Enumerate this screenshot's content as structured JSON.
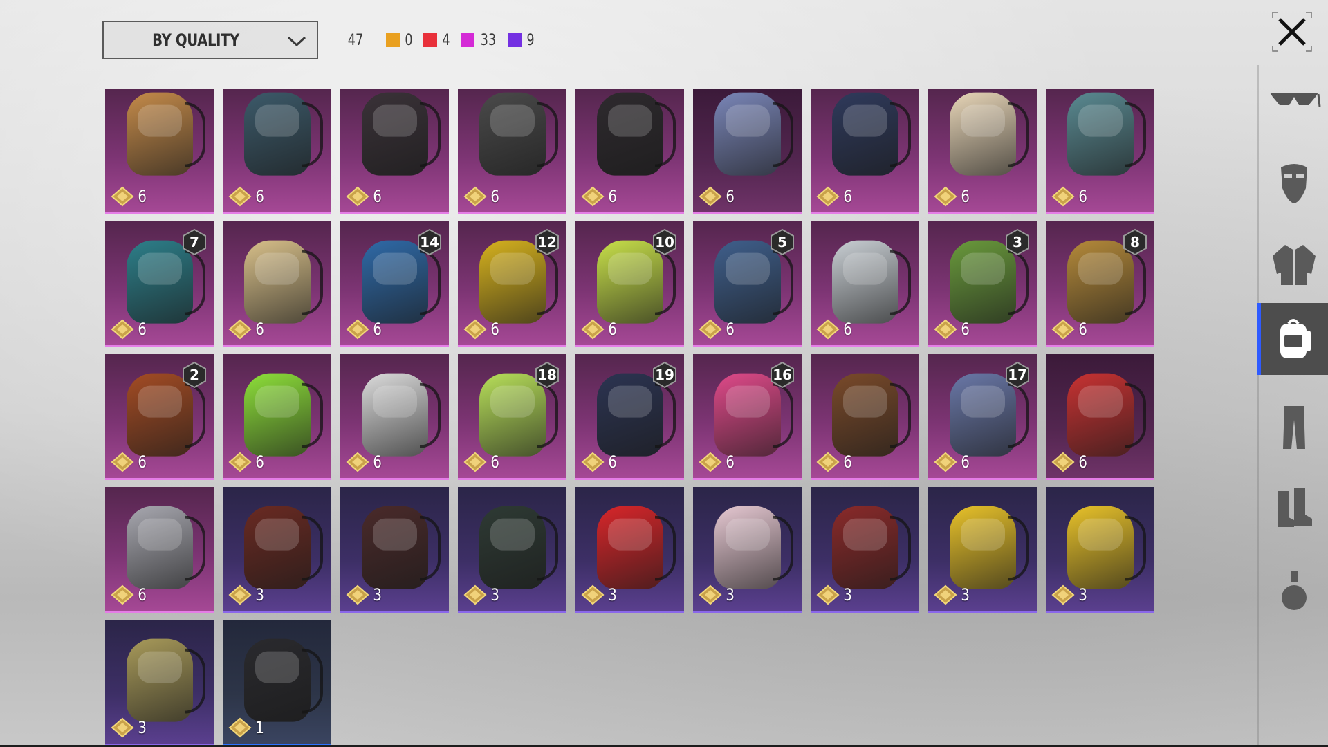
{
  "toolbar": {
    "sort_label": "BY QUALITY",
    "total_count": "47",
    "quality_counts": [
      {
        "color": "#e9a020",
        "count": "0"
      },
      {
        "color": "#e8303a",
        "count": "4"
      },
      {
        "color": "#d42ad6",
        "count": "33"
      },
      {
        "color": "#7430e2",
        "count": "9"
      }
    ]
  },
  "sidebar": {
    "categories": [
      {
        "icon": "glasses-icon",
        "active": false
      },
      {
        "icon": "mask-icon",
        "active": false
      },
      {
        "icon": "jacket-icon",
        "active": false
      },
      {
        "icon": "backpack-icon",
        "active": true
      },
      {
        "icon": "pants-icon",
        "active": false
      },
      {
        "icon": "boots-icon",
        "active": false
      },
      {
        "icon": "grenade-icon",
        "active": false
      }
    ]
  },
  "items": [
    {
      "cost": "6",
      "quality": "q-pink",
      "badge": "",
      "color": "#c58b4a"
    },
    {
      "cost": "6",
      "quality": "q-pink",
      "badge": "",
      "color": "#3c5a6a"
    },
    {
      "cost": "6",
      "quality": "q-pink",
      "badge": "",
      "color": "#3a3238"
    },
    {
      "cost": "6",
      "quality": "q-pink",
      "badge": "",
      "color": "#4a4a4a"
    },
    {
      "cost": "6",
      "quality": "q-pink",
      "badge": "",
      "color": "#2e2a2e"
    },
    {
      "cost": "6",
      "quality": "q-pink-dark",
      "badge": "",
      "color": "#7a86b8"
    },
    {
      "cost": "6",
      "quality": "q-pink",
      "badge": "",
      "color": "#2f3a5c"
    },
    {
      "cost": "6",
      "quality": "q-pink",
      "badge": "",
      "color": "#e8d6b8"
    },
    {
      "cost": "6",
      "quality": "q-pink",
      "badge": "",
      "color": "#5a8a92"
    },
    {
      "cost": "6",
      "quality": "q-pink",
      "badge": "7",
      "color": "#2d7f8a"
    },
    {
      "cost": "6",
      "quality": "q-pink",
      "badge": "",
      "color": "#d8c08a"
    },
    {
      "cost": "6",
      "quality": "q-pink",
      "badge": "14",
      "color": "#2f6aa8"
    },
    {
      "cost": "6",
      "quality": "q-pink",
      "badge": "12",
      "color": "#d6b21e"
    },
    {
      "cost": "6",
      "quality": "q-pink",
      "badge": "10",
      "color": "#c8e04a"
    },
    {
      "cost": "6",
      "quality": "q-pink",
      "badge": "5",
      "color": "#3f5f8c"
    },
    {
      "cost": "6",
      "quality": "q-pink",
      "badge": "",
      "color": "#c9cfd4"
    },
    {
      "cost": "6",
      "quality": "q-pink",
      "badge": "3",
      "color": "#6a9a3c"
    },
    {
      "cost": "6",
      "quality": "q-pink",
      "badge": "8",
      "color": "#b58a3a"
    },
    {
      "cost": "6",
      "quality": "q-pink",
      "badge": "2",
      "color": "#a44c24"
    },
    {
      "cost": "6",
      "quality": "q-pink",
      "badge": "",
      "color": "#8ee03a"
    },
    {
      "cost": "6",
      "quality": "q-pink",
      "badge": "",
      "color": "#dcdcdc"
    },
    {
      "cost": "6",
      "quality": "q-pink",
      "badge": "18",
      "color": "#b8e05a"
    },
    {
      "cost": "6",
      "quality": "q-pink",
      "badge": "19",
      "color": "#2c3452"
    },
    {
      "cost": "6",
      "quality": "q-pink",
      "badge": "16",
      "color": "#e04a8a"
    },
    {
      "cost": "6",
      "quality": "q-pink",
      "badge": "",
      "color": "#7a4a2a"
    },
    {
      "cost": "6",
      "quality": "q-pink",
      "badge": "17",
      "color": "#6a78a8"
    },
    {
      "cost": "6",
      "quality": "q-pink-dark",
      "badge": "",
      "color": "#c83232"
    },
    {
      "cost": "6",
      "quality": "q-pink",
      "badge": "",
      "color": "#a8a8b0"
    },
    {
      "cost": "3",
      "quality": "q-purple",
      "badge": "",
      "color": "#6a2a22"
    },
    {
      "cost": "3",
      "quality": "q-purple",
      "badge": "",
      "color": "#4a2a2a"
    },
    {
      "cost": "3",
      "quality": "q-purple",
      "badge": "",
      "color": "#2e3a34"
    },
    {
      "cost": "3",
      "quality": "q-purple",
      "badge": "",
      "color": "#d8262a"
    },
    {
      "cost": "3",
      "quality": "q-purple",
      "badge": "",
      "color": "#e6c8d2"
    },
    {
      "cost": "3",
      "quality": "q-purple",
      "badge": "",
      "color": "#8a2a2a"
    },
    {
      "cost": "3",
      "quality": "q-purple",
      "badge": "",
      "color": "#e8c22a"
    },
    {
      "cost": "3",
      "quality": "q-purple",
      "badge": "",
      "color": "#e8c22a"
    },
    {
      "cost": "3",
      "quality": "q-purple",
      "badge": "",
      "color": "#a89a5a"
    },
    {
      "cost": "1",
      "quality": "q-blue",
      "badge": "",
      "color": "#2a2a2e"
    }
  ]
}
